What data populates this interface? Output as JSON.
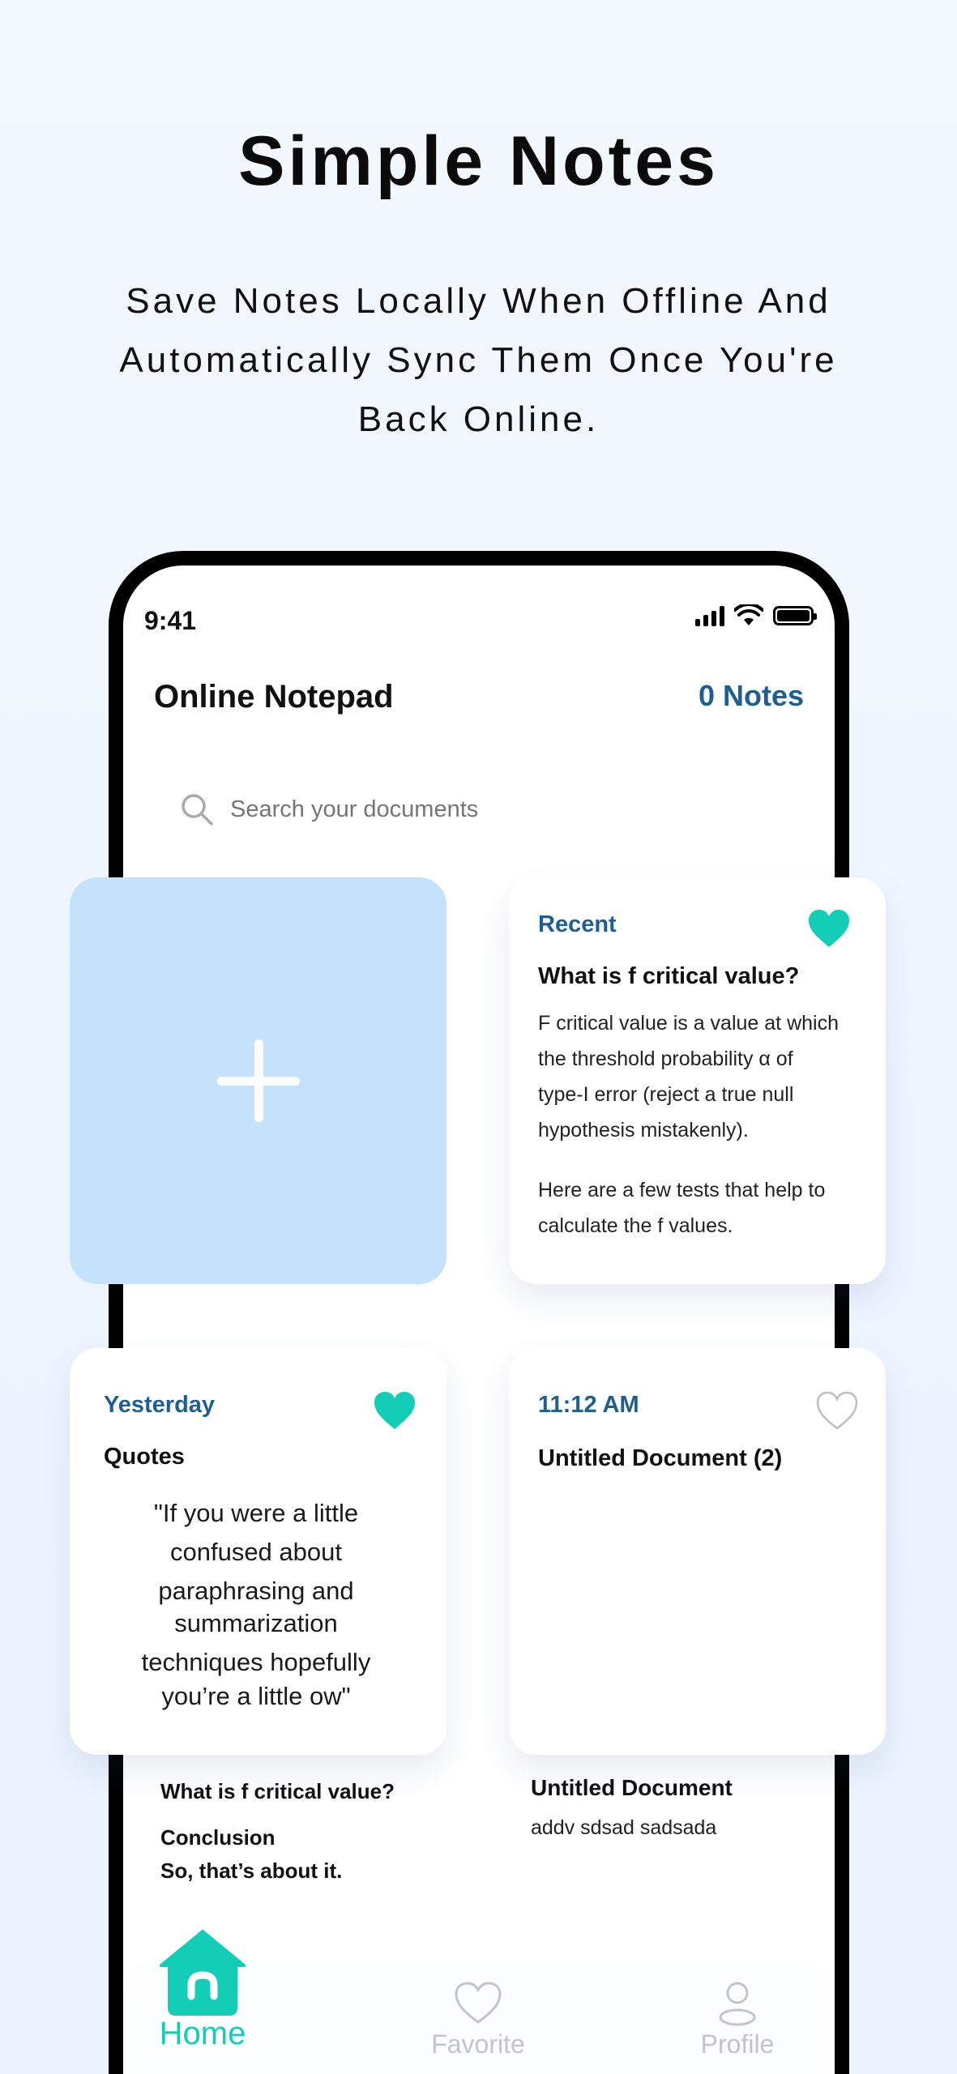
{
  "hero": {
    "title": "Simple Notes",
    "subtitle_line1": "Save Notes Locally When Offline And",
    "subtitle_line2": "Automatically Sync Them Once You're",
    "subtitle_line3": "Back Online."
  },
  "status_bar": {
    "time": "9:41"
  },
  "header": {
    "title": "Online Notepad",
    "notes_count": "0 Notes"
  },
  "search": {
    "placeholder": "Search your documents"
  },
  "cards": [
    {
      "label": "Recent",
      "favorite": true,
      "title": "What is f critical value?",
      "body_lines": [
        "F critical value is a value at which",
        "the threshold probability α of",
        "type-I error (reject a true null",
        "hypothesis mistakenly).",
        "Here are a few tests that help to",
        "calculate the f values."
      ]
    },
    {
      "label": "Yesterday",
      "favorite": true,
      "title": "Quotes",
      "body_lines": [
        "\"If you were a little",
        "confused about",
        "paraphrasing and",
        "summarization",
        "techniques hopefully",
        "you’re a little ow\""
      ]
    },
    {
      "label": "11:12 AM",
      "favorite": false,
      "title": "Untitled Document (2)",
      "body_lines": []
    }
  ],
  "list_items": [
    {
      "title": "What is f critical value?",
      "sub1": "Conclusion",
      "sub2": "So, that’s about it."
    },
    {
      "title": "Untitled Document",
      "sub1": "addv sdsad sadsada"
    }
  ],
  "nav": {
    "home": "Home",
    "favorite": "Favorite",
    "profile": "Profile"
  },
  "colors": {
    "accent_teal": "#14cdb7",
    "label_blue": "#1d5f92",
    "add_card_bg": "#c5e2fc"
  }
}
